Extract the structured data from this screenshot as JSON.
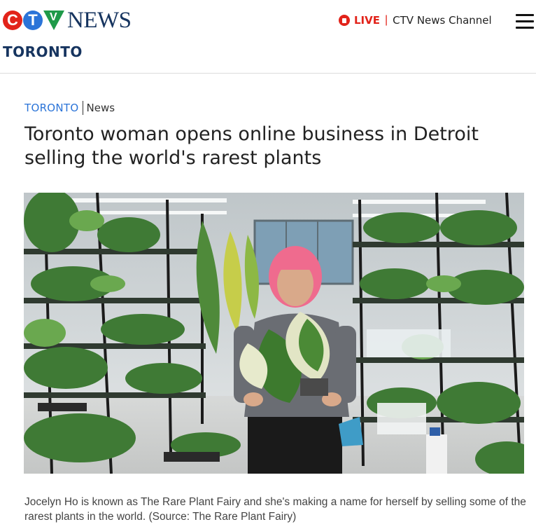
{
  "header": {
    "logo_letters": [
      "C",
      "T",
      "V"
    ],
    "logo_word": "NEWS",
    "region": "TORONTO",
    "live_label": "LIVE",
    "live_separator": "|",
    "channel_label": "CTV News Channel",
    "brand_colors": {
      "red": "#e2231a",
      "blue": "#2b74d8",
      "green": "#1f9a49",
      "navy": "#16345f"
    },
    "icons": [
      "live-icon",
      "hamburger-menu-icon"
    ]
  },
  "article": {
    "breadcrumb_region": "TORONTO",
    "breadcrumb_section": "News",
    "headline": "Toronto woman opens online business in Detroit selling the world's rarest plants",
    "caption": "Jocelyn Ho is known as The Rare Plant Fairy and she's making a name for herself by selling some of the rarest plants in the world. (Source: The Rare Plant Fairy)"
  }
}
